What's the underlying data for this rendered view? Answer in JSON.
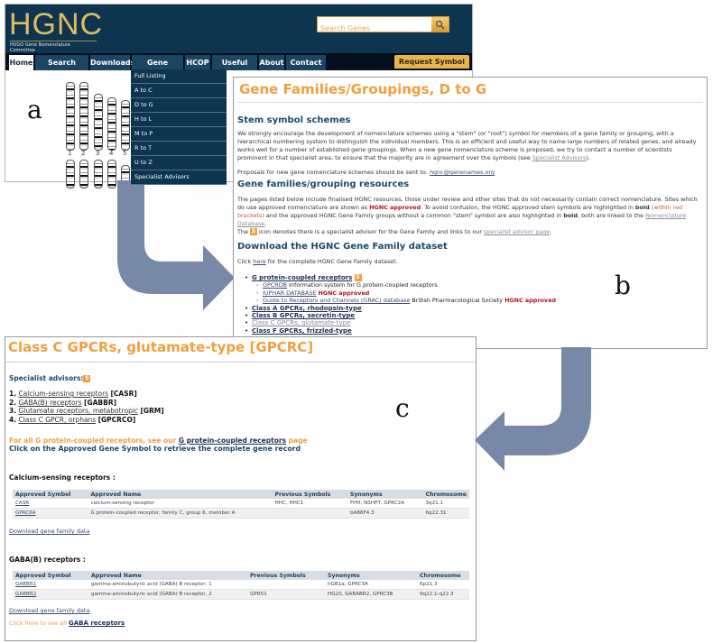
{
  "panel_labels": {
    "a": "a",
    "b": "b",
    "c": "c"
  },
  "colors": {
    "header_bg": "#0d3550",
    "accent_orange": "#f0a03c",
    "heading_blue": "#1b4a6b",
    "approved_red": "#b3121b",
    "arrow": "#7889a8"
  },
  "site": {
    "logo": "HGNC",
    "logo_subtitle": "HUGO Gene Nomenclature Committee",
    "search_placeholder": "Search Genes",
    "search_icon": "magnifier-icon",
    "nav": [
      "Home",
      "Search Genes",
      "Downloads",
      "Gene Families",
      "HCOP",
      "Useful Links",
      "About",
      "Contact Us"
    ],
    "active_nav": "Home",
    "request_button": "Request Symbol",
    "dropdown": [
      "Full Listing",
      "A to C",
      "D to G",
      "H to L",
      "M to P",
      "R to T",
      "U to Z",
      "Specialist Advisors"
    ],
    "chromosome_labels": [
      "1",
      "2",
      "3",
      "4",
      "5"
    ]
  },
  "page_b": {
    "title": "Gene Families/Groupings, D to G",
    "stem_heading": "Stem symbol schemes",
    "stem_text": "We strongly encourage the development of nomenclature schemes using a \"stem\" (or \"root\") symbol for members of a gene family or grouping, with a hierarchical numbering system to distinguish the individual members. This is an efficient and useful way to name large numbers of related genes, and already works well for a number of established gene groupings. When a new gene nomenclature scheme is proposed, we try to contact a number of scientists prominent in that specialist area, to ensure that the majority are in agreement over the symbols (see ",
    "stem_link": "Specialist Advisors",
    "stem_end": ").",
    "proposals_text": "Proposals for new gene nomenclature schemes should be sent to: ",
    "proposals_email": "hgnc@genenames.org",
    "resources_heading": "Gene families/grouping resources",
    "resources_text_1": "The pages listed below include finalised HGNC resources, those under review and other sites that do not necessarily contain correct nomenclature. Sites which do use approved nomenclature are shown as ",
    "hgnc_approved": "HGNC approved",
    "resources_text_2": ". To avoid confusion, the HGNC approved stem symbols are highlighted in ",
    "bold_word": "bold",
    "red_brackets": "(within red brackets)",
    "resources_text_3": " and the approved HGNC Gene Family groups without a common \"stem\" symbol are also highlighted in ",
    "resources_text_4": ", both are linked to the ",
    "nomenclature_db_link": "Nomenclature Database",
    "icon_text_1": "The ",
    "s_icon": "S",
    "icon_text_2": " icon denotes there is a specialist advisor for the Gene Family and links to our ",
    "advisor_page_link": "specialist advisor page",
    "download_heading": "Download the HGNC Gene Family dataset",
    "click_text_1": "Click ",
    "click_here": "here",
    "click_text_2": " for the complete HGNC Gene Family dataset.",
    "list": {
      "gpcr": "G protein-coupled receptors",
      "gpcrdb_link": "GPCRDB",
      "gpcrdb_text": " Information system for G protein-coupled receptors",
      "iuphar_link": "IUPHAR DATABASE",
      "grac_link": "Guide to Receptors and Channels (GRAC) database",
      "grac_text": " British Pharmacological Society ",
      "class_a": "Class A GPCRs, rhodopsin-type",
      "class_b": "Class B GPCRs, secretin-type",
      "class_c": "Class C GPCRs, glutamate-type",
      "class_f": "Class F GPCRs, frizzled-type"
    }
  },
  "page_c": {
    "title": "Class C GPCRs, glutamate-type [GPCRC]",
    "advisors_label": "Specialist advisors:",
    "advisors": [
      {
        "num": "1.",
        "link": "Calcium-sensing receptors",
        "code": "[CASR]"
      },
      {
        "num": "2.",
        "link": "GABA(B) receptors",
        "code": "[GABBR]"
      },
      {
        "num": "3.",
        "link": "Glutamate receptors, metabotropic",
        "code": "[GRM]"
      },
      {
        "num": "4.",
        "link": "Class C GPCR, orphans",
        "code": "[GPCRCO]"
      }
    ],
    "gpcr_note_1": "For all G protein-coupled receptors, see our ",
    "gpcr_note_link": "G protein-coupled receptors",
    "gpcr_note_2": " page",
    "click_note": "Click on the Approved Gene Symbol to retrieve the complete gene record",
    "columns": [
      "Approved Symbol",
      "Approved Name",
      "Previous Symbols",
      "Synonyms",
      "Chromosome"
    ],
    "sections": [
      {
        "title": "Calcium-sensing receptors :",
        "rows": [
          [
            "CASR",
            "calcium-sensing receptor",
            "HHC, HHC1",
            "FHH, NSHPT, GPRC2A",
            "3q21.1"
          ],
          [
            "GPRC6A",
            "G protein-coupled receptor, family C, group 6, member A",
            "",
            "bA86F4.3",
            "6q22.31"
          ]
        ],
        "download": "Download gene family data"
      },
      {
        "title": "GABA(B) receptors :",
        "rows": [
          [
            "GABBR1",
            "gamma-aminobutyric acid (GABA) B receptor, 1",
            "",
            "hGB1a, GPRC3A",
            "6p21.3"
          ],
          [
            "GABBR2",
            "gamma-aminobutyric acid (GABA) B receptor, 2",
            "GPR51",
            "HG20, GABABR2, GPRC3B",
            "9q22.1-q22.3"
          ]
        ],
        "download": "Download gene family data"
      }
    ],
    "gaba_note": "Click here to see all ",
    "gaba_link": "GABA receptors"
  }
}
